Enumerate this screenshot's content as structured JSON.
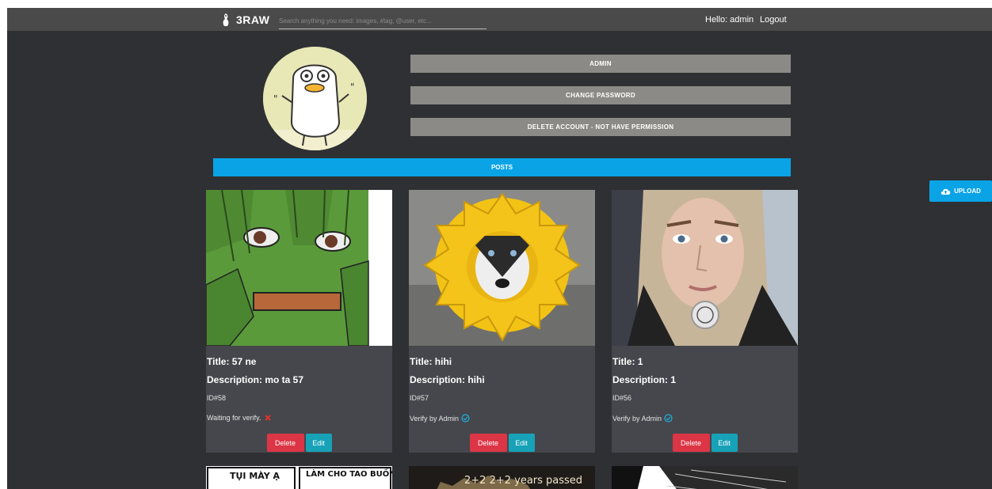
{
  "header": {
    "brand": "3RAW",
    "search_placeholder": "Search anything you need: images, #tag, @user, etc...",
    "greeting": "Hello: admin",
    "logout": "Logout"
  },
  "profile": {
    "name_button": "ADMIN",
    "change_password": "CHANGE PASSWORD",
    "delete_account": "DELETE ACCOUNT - NOT HAVE PERMISSION"
  },
  "posts_label": "POSTS",
  "upload_label": "UPLOAD",
  "colors": {
    "accent": "#0aa3e6",
    "danger": "#dc3545",
    "info": "#17a2b8",
    "verified": "#1fb0e0",
    "unverified": "#e0322d"
  },
  "posts": [
    {
      "title": "Title: 57 ne",
      "description": "Description: mo ta 57",
      "id": "ID#58",
      "status": "Waiting for verify.",
      "verified": false,
      "image": "frog-meme",
      "delete": "Delete",
      "edit": "Edit"
    },
    {
      "title": "Title: hihi",
      "description": "Description: hihi",
      "id": "ID#57",
      "status": "Verify by Admin",
      "verified": true,
      "image": "dog-flower",
      "delete": "Delete",
      "edit": "Edit"
    },
    {
      "title": "Title: 1",
      "description": "Description: 1",
      "id": "ID#56",
      "status": "Verify by Admin",
      "verified": true,
      "image": "woman-portrait",
      "delete": "Delete",
      "edit": "Edit"
    }
  ],
  "next_row": [
    {
      "image": "comic-meme",
      "caption_left": "TỤI MÀY Ạ",
      "caption_right": "LÀM CHO TAO BUỒN ĐƯỢC HẾT..."
    },
    {
      "image": "chess-meme",
      "caption": "2+2  2+2  years passed"
    },
    {
      "image": "manga-panel"
    }
  ]
}
